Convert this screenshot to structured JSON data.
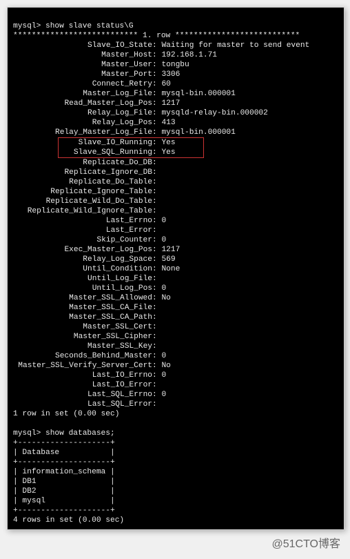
{
  "prompt1": "mysql> show slave status\\G",
  "row_header": "*************************** 1. row ***************************",
  "status": [
    {
      "label": "Slave_IO_State",
      "value": "Waiting for master to send event"
    },
    {
      "label": "Master_Host",
      "value": "192.168.1.71"
    },
    {
      "label": "Master_User",
      "value": "tongbu"
    },
    {
      "label": "Master_Port",
      "value": "3306"
    },
    {
      "label": "Connect_Retry",
      "value": "60"
    },
    {
      "label": "Master_Log_File",
      "value": "mysql-bin.000001"
    },
    {
      "label": "Read_Master_Log_Pos",
      "value": "1217"
    },
    {
      "label": "Relay_Log_File",
      "value": "mysqld-relay-bin.000002"
    },
    {
      "label": "Relay_Log_Pos",
      "value": "413"
    },
    {
      "label": "Relay_Master_Log_File",
      "value": "mysql-bin.000001"
    }
  ],
  "highlighted": [
    {
      "label": "Slave_IO_Running",
      "value": "Yes"
    },
    {
      "label": "Slave_SQL_Running",
      "value": "Yes"
    }
  ],
  "status2": [
    {
      "label": "Replicate_Do_DB",
      "value": ""
    },
    {
      "label": "Replicate_Ignore_DB",
      "value": ""
    },
    {
      "label": "Replicate_Do_Table",
      "value": ""
    },
    {
      "label": "Replicate_Ignore_Table",
      "value": ""
    },
    {
      "label": "Replicate_Wild_Do_Table",
      "value": ""
    },
    {
      "label": "Replicate_Wild_Ignore_Table",
      "value": ""
    },
    {
      "label": "Last_Errno",
      "value": "0"
    },
    {
      "label": "Last_Error",
      "value": ""
    },
    {
      "label": "Skip_Counter",
      "value": "0"
    },
    {
      "label": "Exec_Master_Log_Pos",
      "value": "1217"
    },
    {
      "label": "Relay_Log_Space",
      "value": "569"
    },
    {
      "label": "Until_Condition",
      "value": "None"
    },
    {
      "label": "Until_Log_File",
      "value": ""
    },
    {
      "label": "Until_Log_Pos",
      "value": "0"
    },
    {
      "label": "Master_SSL_Allowed",
      "value": "No"
    },
    {
      "label": "Master_SSL_CA_File",
      "value": ""
    },
    {
      "label": "Master_SSL_CA_Path",
      "value": ""
    },
    {
      "label": "Master_SSL_Cert",
      "value": ""
    },
    {
      "label": "Master_SSL_Cipher",
      "value": ""
    },
    {
      "label": "Master_SSL_Key",
      "value": ""
    },
    {
      "label": "Seconds_Behind_Master",
      "value": "0"
    },
    {
      "label": "Master_SSL_Verify_Server_Cert",
      "value": "No"
    },
    {
      "label": "Last_IO_Errno",
      "value": "0"
    },
    {
      "label": "Last_IO_Error",
      "value": ""
    },
    {
      "label": "Last_SQL_Errno",
      "value": "0"
    },
    {
      "label": "Last_SQL_Error",
      "value": ""
    }
  ],
  "result1": "1 row in set (0.00 sec)",
  "prompt2": "mysql> show databases;",
  "db_border": "+--------------------+",
  "db_header": "| Database           |",
  "db_rows": [
    "| information_schema |",
    "| DB1                |",
    "| DB2                |",
    "| mysql              |"
  ],
  "result2": "4 rows in set (0.00 sec)",
  "watermark": "@51CTO博客"
}
